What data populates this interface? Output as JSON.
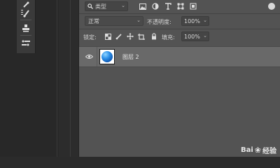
{
  "layers_panel": {
    "filter": {
      "kind_label": "类型",
      "icons": [
        "image-icon",
        "adjustment-icon",
        "type-icon",
        "shape-icon",
        "smart-object-icon"
      ]
    },
    "blend_mode": "正常",
    "opacity": {
      "label": "不透明度:",
      "value": "100%"
    },
    "lock": {
      "label": "锁定:",
      "icons": [
        "lock-transparent-icon",
        "lock-paint-icon",
        "lock-position-icon",
        "lock-artboard-icon",
        "lock-all-icon"
      ]
    },
    "fill": {
      "label": "填充:",
      "value": "100%"
    },
    "layers": [
      {
        "name": "图层 2",
        "visible": true,
        "thumbnail": "blue-sphere"
      }
    ]
  },
  "toolbar": {
    "tools": [
      "healing-brush-icon",
      "brush-icon",
      "stamp-icon",
      "history-brush-icon"
    ]
  },
  "watermark": {
    "left": "Bai",
    "right": "经验"
  },
  "colors": {
    "panel_bg": "#535353",
    "selected_row": "#696969",
    "app_bg": "#2b2b2b"
  }
}
